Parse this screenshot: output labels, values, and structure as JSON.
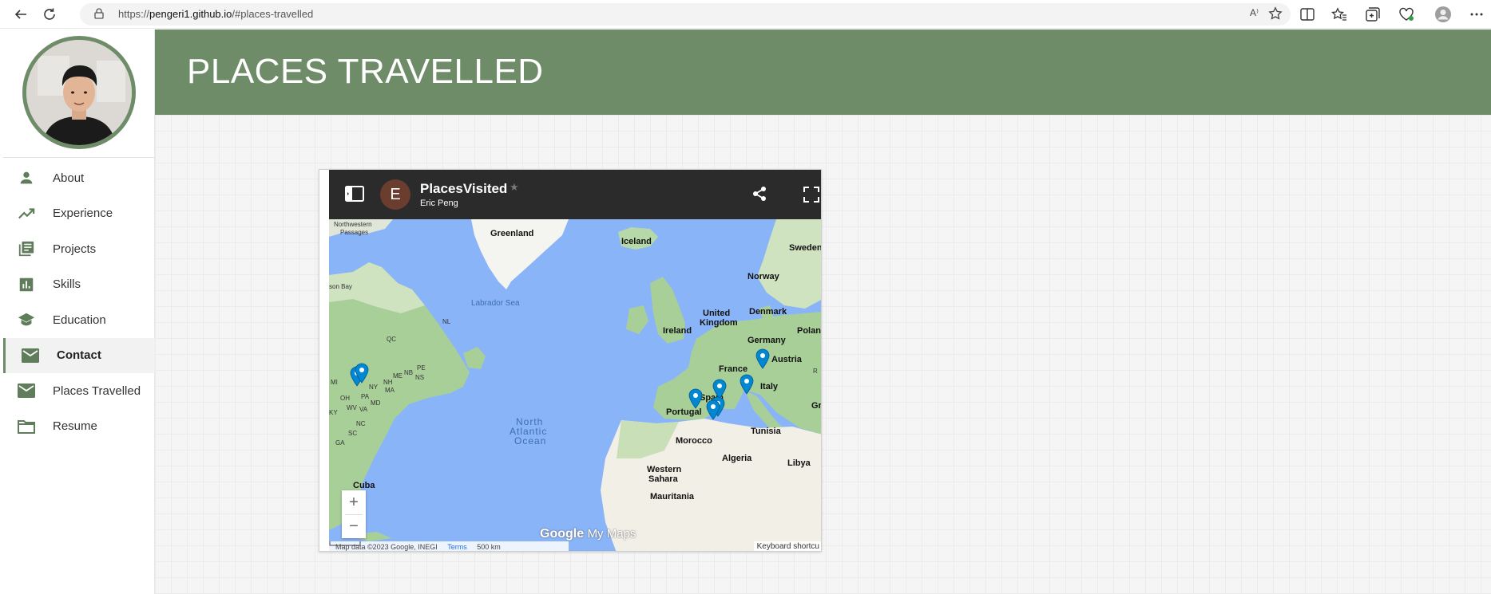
{
  "browser": {
    "url_prefix": "https://",
    "url_host": "pengeri1.github.io",
    "url_path": "/#places-travelled",
    "read_aloud": "A⁾"
  },
  "sidebar": {
    "items": [
      {
        "label": "About",
        "icon": "person-icon"
      },
      {
        "label": "Experience",
        "icon": "trending-up-icon"
      },
      {
        "label": "Projects",
        "icon": "library-books-icon"
      },
      {
        "label": "Skills",
        "icon": "bar-chart-icon"
      },
      {
        "label": "Education",
        "icon": "school-icon"
      },
      {
        "label": "Contact",
        "icon": "mail-icon",
        "active": true
      },
      {
        "label": "Places Travelled",
        "icon": "mail-icon"
      },
      {
        "label": "Resume",
        "icon": "folder-icon"
      }
    ]
  },
  "header": {
    "title": "PLACES TRAVELLED"
  },
  "map": {
    "avatar_letter": "E",
    "title": "PlacesVisited",
    "star": "★",
    "author": "Eric Peng",
    "zoom_in": "+",
    "zoom_out": "−",
    "logo_google": "Google",
    "logo_mymaps": "My Maps",
    "attribution": "Map data ©2023 Google, INEGI",
    "terms": "Terms",
    "scale": "500 km",
    "keyboard": "Keyboard shortcu",
    "labels": {
      "greenland": "Greenland",
      "iceland": "Iceland",
      "sweden": "Sweden",
      "norway": "Norway",
      "northwestern": "Northwestern",
      "passages": "Passages",
      "hudson": "son Bay",
      "labrador": "Labrador Sea",
      "uk1": "United",
      "uk2": "Kingdom",
      "denmark": "Denmark",
      "ireland": "Ireland",
      "germany": "Germany",
      "poland": "Polan",
      "france": "France",
      "austria": "Austria",
      "italy": "Italy",
      "spain": "Spain",
      "portugal": "Portugal",
      "tunisia": "Tunisia",
      "morocco": "Morocco",
      "algeria": "Algeria",
      "libya": "Libya",
      "wsahara1": "Western",
      "wsahara2": "Sahara",
      "mauritania": "Mauritania",
      "cuba": "Cuba",
      "ocean1": "North",
      "ocean2": "Atlantic",
      "ocean3": "Ocean",
      "nl": "NL",
      "qc": "QC",
      "pe": "PE",
      "nb": "NB",
      "ns": "NS",
      "me": "ME",
      "mi": "MI",
      "ny": "NY",
      "nh": "NH",
      "ma": "MA",
      "oh": "OH",
      "pa": "PA",
      "md": "MD",
      "ky": "KY",
      "wv": "WV",
      "va": "VA",
      "nc": "NC",
      "sc": "SC",
      "ga": "GA",
      "gr": "Gr",
      "r": "R"
    }
  }
}
